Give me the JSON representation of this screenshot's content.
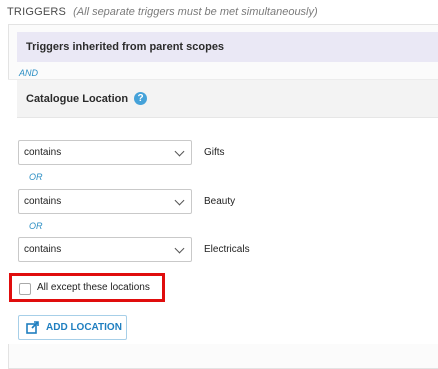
{
  "section": {
    "title": "TRIGGERS",
    "subtitle": "(All separate triggers must be met simultaneously)"
  },
  "inherited": {
    "label": "Triggers inherited from parent scopes"
  },
  "joiner": {
    "and": "AND",
    "or": "OR"
  },
  "catalogue": {
    "label": "Catalogue Location",
    "help_icon": "?"
  },
  "conditions": [
    {
      "operator": "contains",
      "value": "Gifts"
    },
    {
      "operator": "contains",
      "value": "Beauty"
    },
    {
      "operator": "contains",
      "value": "Electricals"
    }
  ],
  "except": {
    "label": "All except these locations",
    "checked": false,
    "highlight_color": "#e00d0d"
  },
  "add_button": {
    "label": "ADD LOCATION",
    "icon": "external-add-icon"
  },
  "colors": {
    "accent": "#2d8fc4",
    "inherited_bg": "#eae8f5"
  }
}
